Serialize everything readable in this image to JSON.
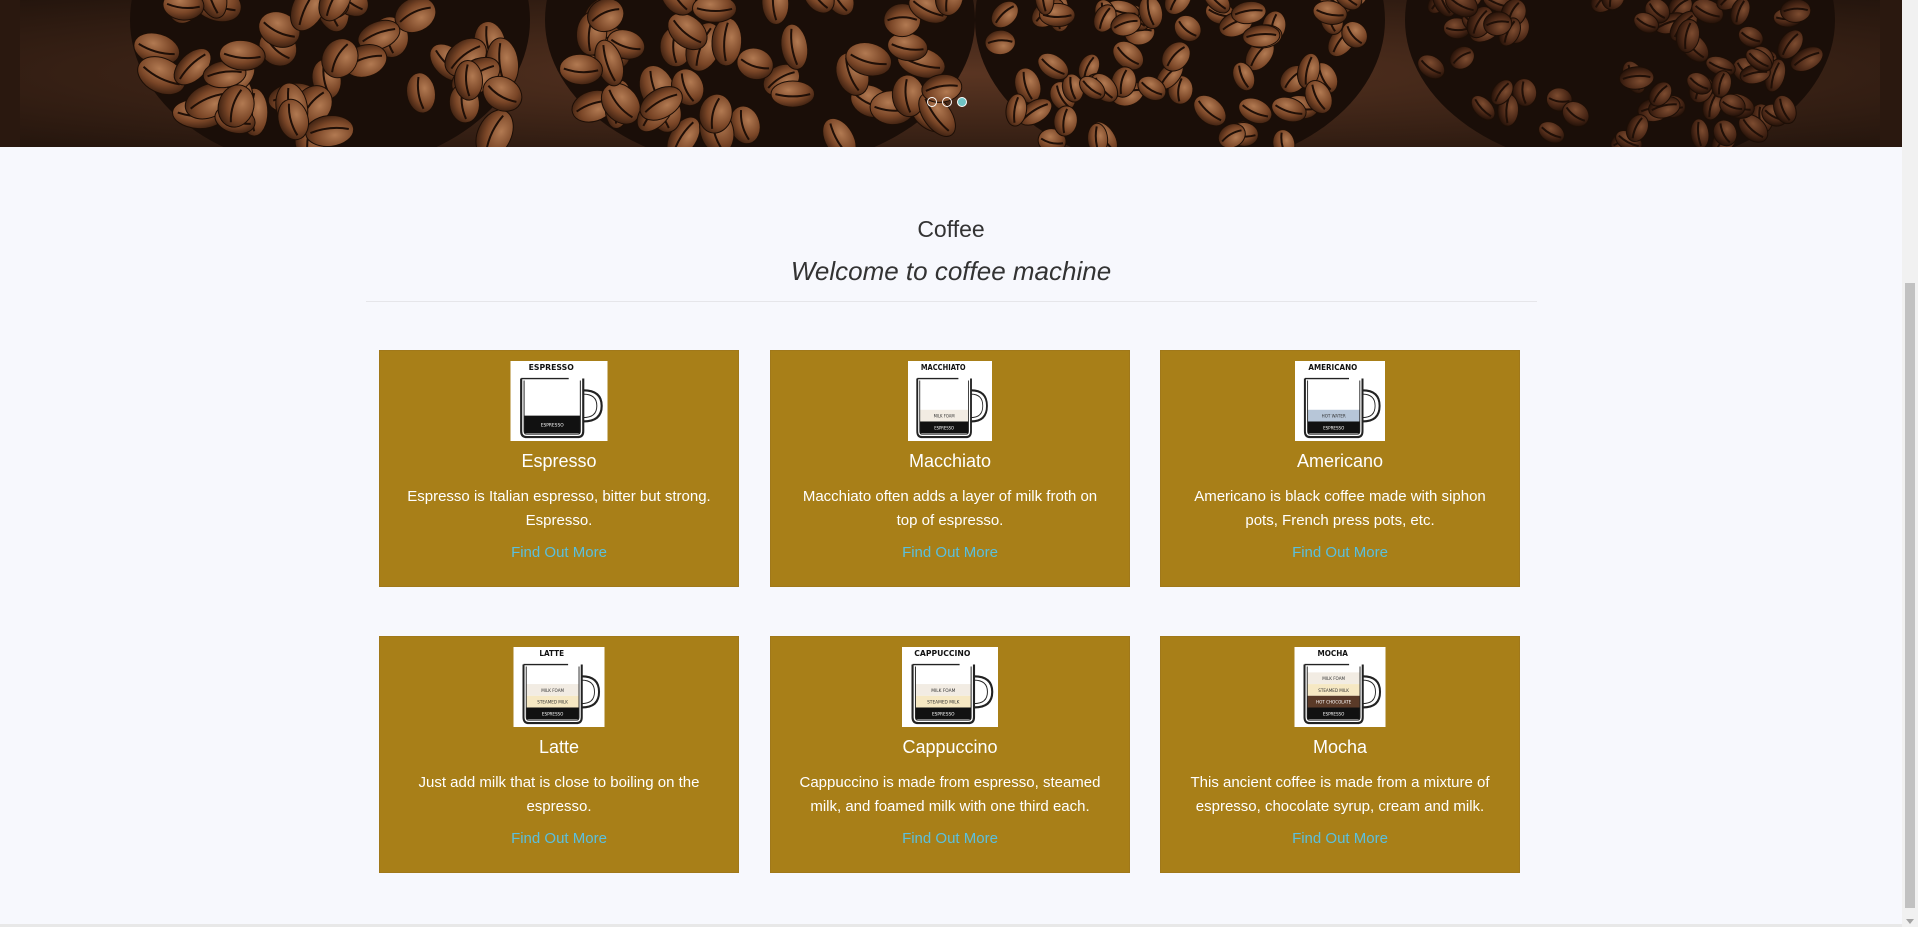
{
  "hero": {
    "slides": 3,
    "active_slide": 3
  },
  "section": {
    "title": "Coffee",
    "subtitle": "Welcome to coffee machine"
  },
  "cards": [
    {
      "image_label": "ESPRESSO",
      "layers": [
        "ESPRESSO"
      ],
      "name": "Espresso",
      "description": "Espresso is Italian espresso, bitter but strong. Espresso.",
      "link": "Find Out More"
    },
    {
      "image_label": "MACCHIATO",
      "layers": [
        "MILK FOAM",
        "ESPRESSO"
      ],
      "name": "Macchiato",
      "description": "Macchiato often adds a layer of milk froth on top of espresso.",
      "link": "Find Out More"
    },
    {
      "image_label": "AMERICANO",
      "layers": [
        "HOT WATER",
        "ESPRESSO"
      ],
      "name": "Americano",
      "description": "Americano is black coffee made with siphon pots, French press pots, etc.",
      "link": "Find Out More"
    },
    {
      "image_label": "LATTE",
      "layers": [
        "MILK FOAM",
        "STEAMED MILK",
        "ESPRESSO"
      ],
      "name": "Latte",
      "description": "Just add milk that is close to boiling on the espresso.",
      "link": "Find Out More"
    },
    {
      "image_label": "CAPPUCCINO",
      "layers": [
        "MILK FOAM",
        "STEAMED MILK",
        "ESPRESSO"
      ],
      "name": "Cappuccino",
      "description": "Cappuccino is made from espresso, steamed milk, and foamed milk with one third each.",
      "link": "Find Out More"
    },
    {
      "image_label": "MOCHA",
      "layers": [
        "MILK FOAM",
        "STEAMED MILK",
        "HOT CHOCOLATE",
        "ESPRESSO"
      ],
      "name": "Mocha",
      "description": "This ancient coffee is made from a mixture of espresso, chocolate syrup, cream and milk.",
      "link": "Find Out More"
    }
  ],
  "colors": {
    "card_bg": "#a87f18",
    "link": "#5bc0de",
    "page_bg": "#f7f8fd",
    "active_dot": "#6fc3c3"
  }
}
